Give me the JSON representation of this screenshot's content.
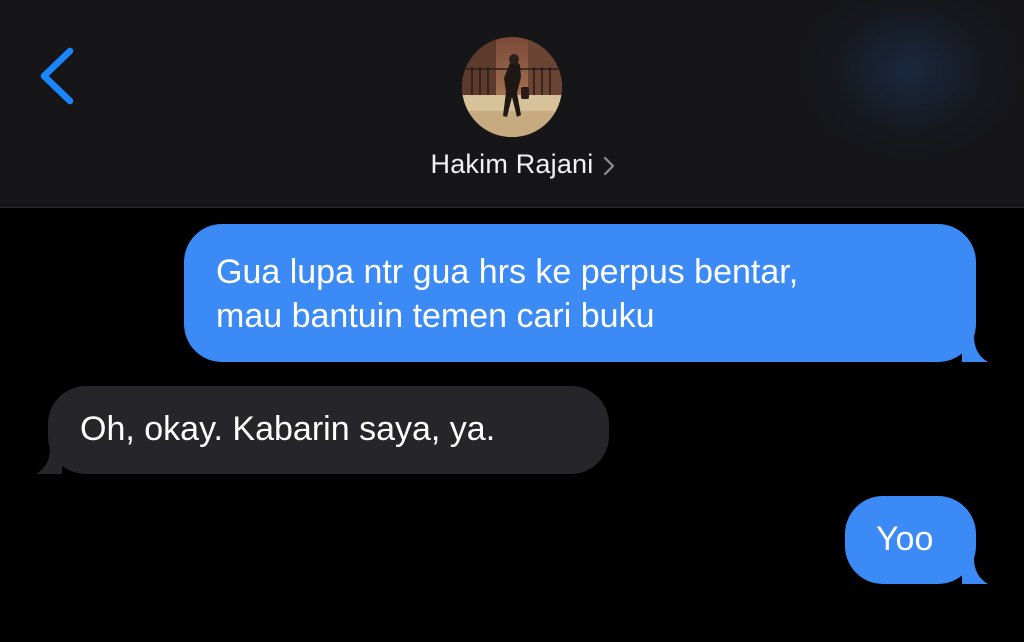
{
  "header": {
    "contact_name": "Hakim Rajani",
    "back_icon": "chevron-left-icon",
    "detail_icon": "chevron-right-icon",
    "avatar_icon": "avatar-photo"
  },
  "messages": [
    {
      "direction": "outgoing",
      "lines": [
        "Gua lupa ntr gua hrs ke perpus bentar,",
        "mau bantuin temen cari buku"
      ]
    },
    {
      "direction": "incoming",
      "lines": [
        "Oh, okay. Kabarin saya, ya."
      ]
    },
    {
      "direction": "outgoing",
      "lines": [
        "Yoo"
      ]
    }
  ],
  "colors": {
    "background": "#000000",
    "header_background": "#161618",
    "outgoing_bubble": "#3b8af5",
    "incoming_bubble": "#26252a",
    "accent": "#1a86ff",
    "text": "#ffffff"
  }
}
